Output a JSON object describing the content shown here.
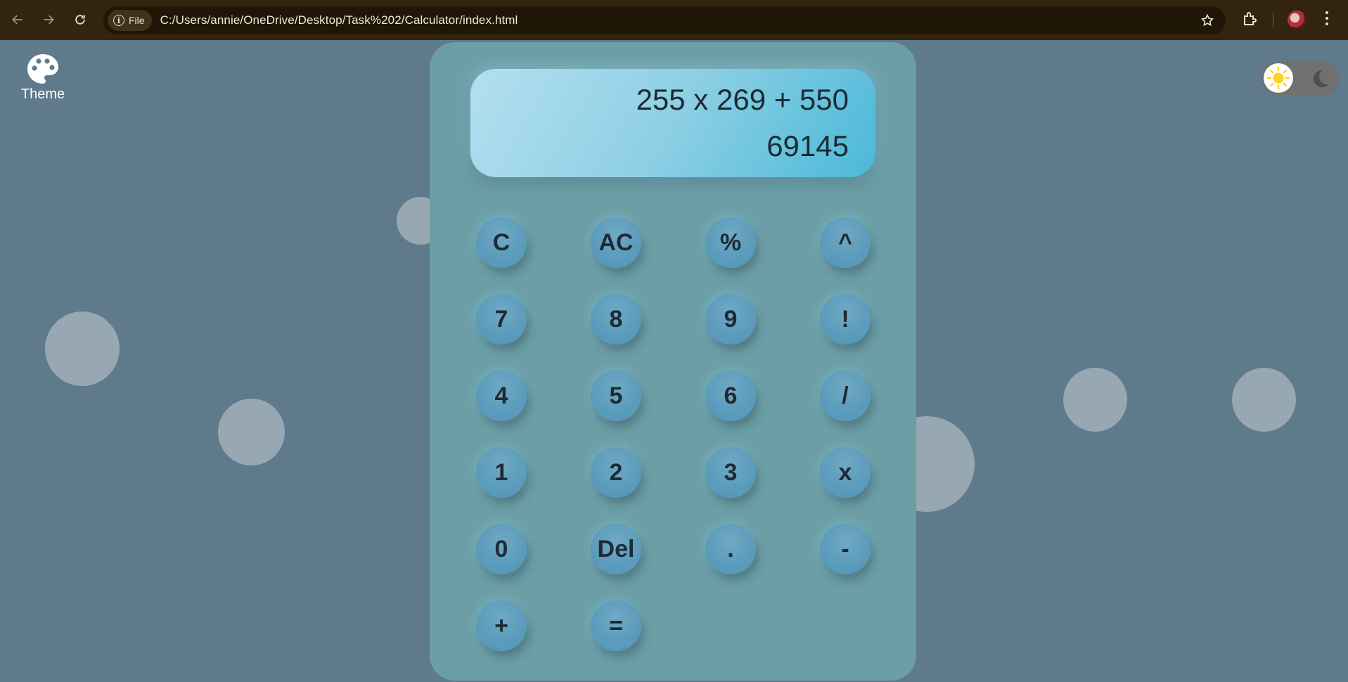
{
  "browser": {
    "file_chip_label": "File",
    "url": "C:/Users/annie/OneDrive/Desktop/Task%202/Calculator/index.html"
  },
  "theme": {
    "label": "Theme"
  },
  "calculator": {
    "expression": "255 x 269 + 550",
    "result": "69145",
    "keys": {
      "clear": "C",
      "all_clear": "AC",
      "percent": "%",
      "power": "^",
      "seven": "7",
      "eight": "8",
      "nine": "9",
      "factorial": "!",
      "four": "4",
      "five": "5",
      "six": "6",
      "divide": "/",
      "one": "1",
      "two": "2",
      "three": "3",
      "multiply": "x",
      "zero": "0",
      "delete": "Del",
      "decimal": ".",
      "minus": "-",
      "plus": "+",
      "equals": "="
    }
  },
  "colors": {
    "page_background": "#5f7a8b",
    "calculator_body": "#6c9ea6",
    "key": "#5b9bbb",
    "browser_chrome": "#33250d"
  },
  "icons": [
    "back-arrow-icon",
    "forward-arrow-icon",
    "reload-icon",
    "info-icon",
    "star-icon",
    "extensions-icon",
    "profile-avatar",
    "kebab-menu-icon",
    "palette-icon",
    "sun-icon",
    "moon-icon"
  ]
}
